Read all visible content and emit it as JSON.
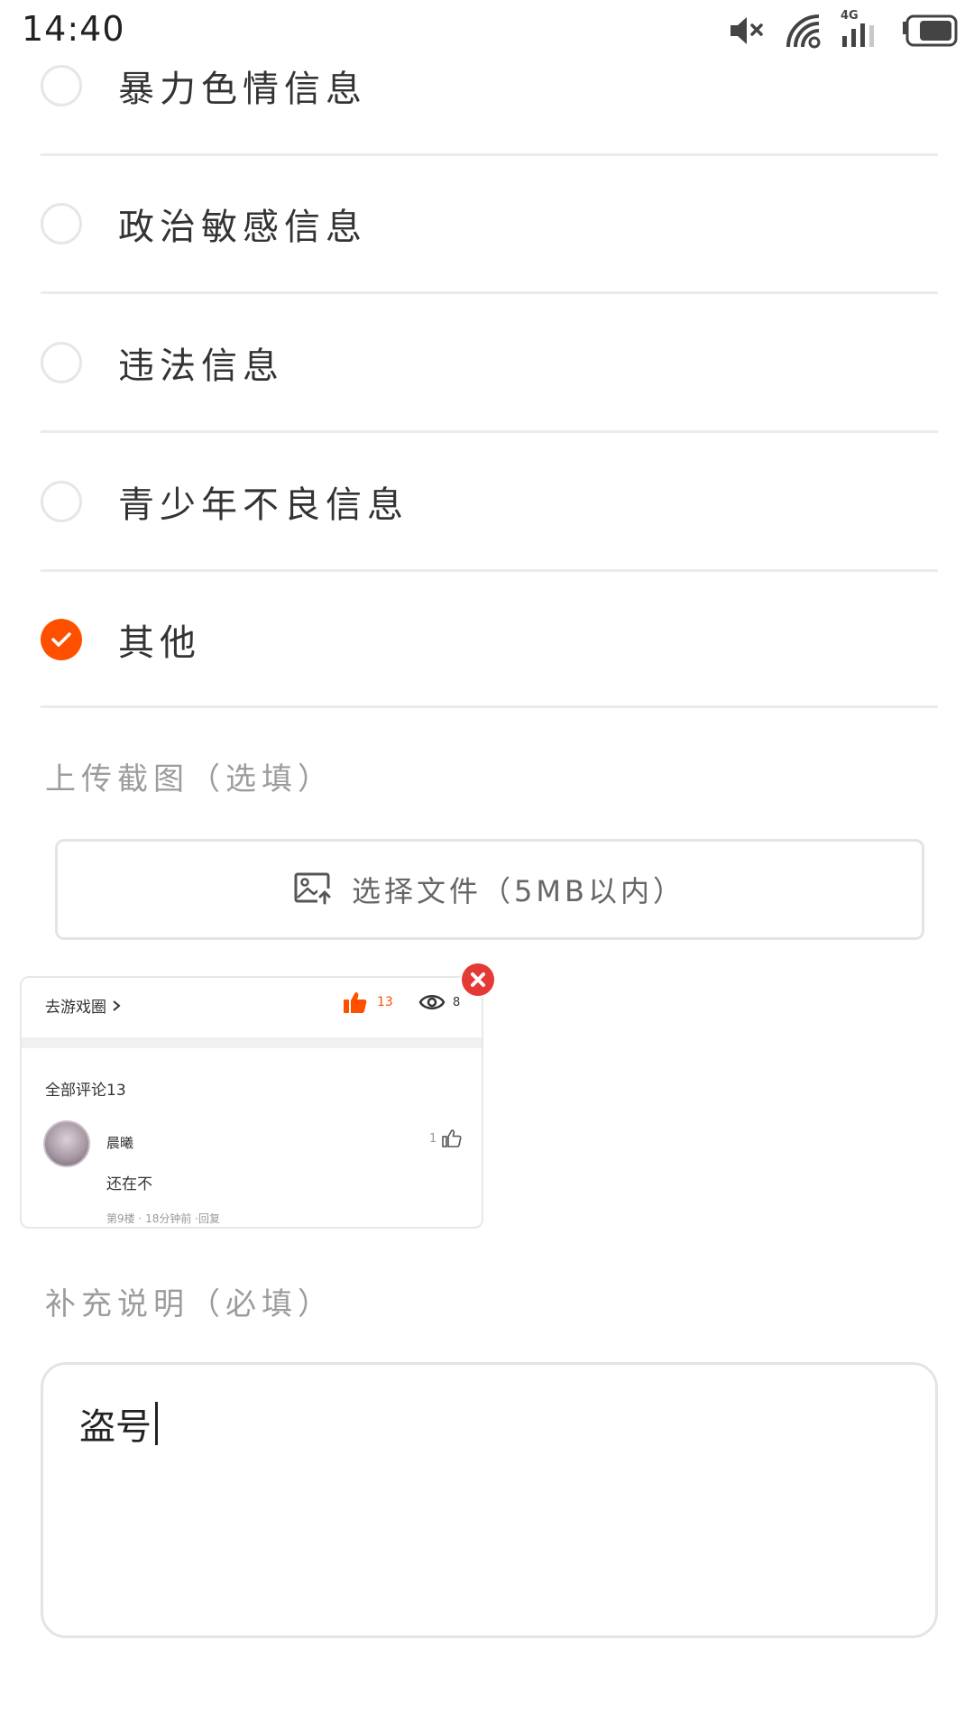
{
  "status_bar": {
    "time": "14:40",
    "network": "4G",
    "icons": [
      "mute-icon",
      "wifi-icon",
      "cellular-signal-icon",
      "battery-icon"
    ]
  },
  "report_options": [
    {
      "label": "暴力色情信息",
      "checked": false
    },
    {
      "label": "政治敏感信息",
      "checked": false
    },
    {
      "label": "违法信息",
      "checked": false
    },
    {
      "label": "青少年不良信息",
      "checked": false
    },
    {
      "label": "其他",
      "checked": true
    }
  ],
  "upload": {
    "section_label": "上传截图（选填）",
    "button_label": "选择文件（5MB以内）",
    "icon": "image-upload-icon"
  },
  "screenshot_preview": {
    "goto_label": "去游戏圈",
    "like_count": "13",
    "view_count": "8",
    "comments_header": "全部评论13",
    "reply": {
      "username": "晨曦",
      "like_count": "1",
      "text": "还在不",
      "meta": "第9楼 · 18分钟前 ·回复"
    }
  },
  "description": {
    "section_label": "补充说明（必填）",
    "value": "盗号"
  },
  "colors": {
    "accent": "#ff5000",
    "remove": "#e53935",
    "divider": "#ebebeb",
    "muted_text": "#9c9c9c"
  }
}
